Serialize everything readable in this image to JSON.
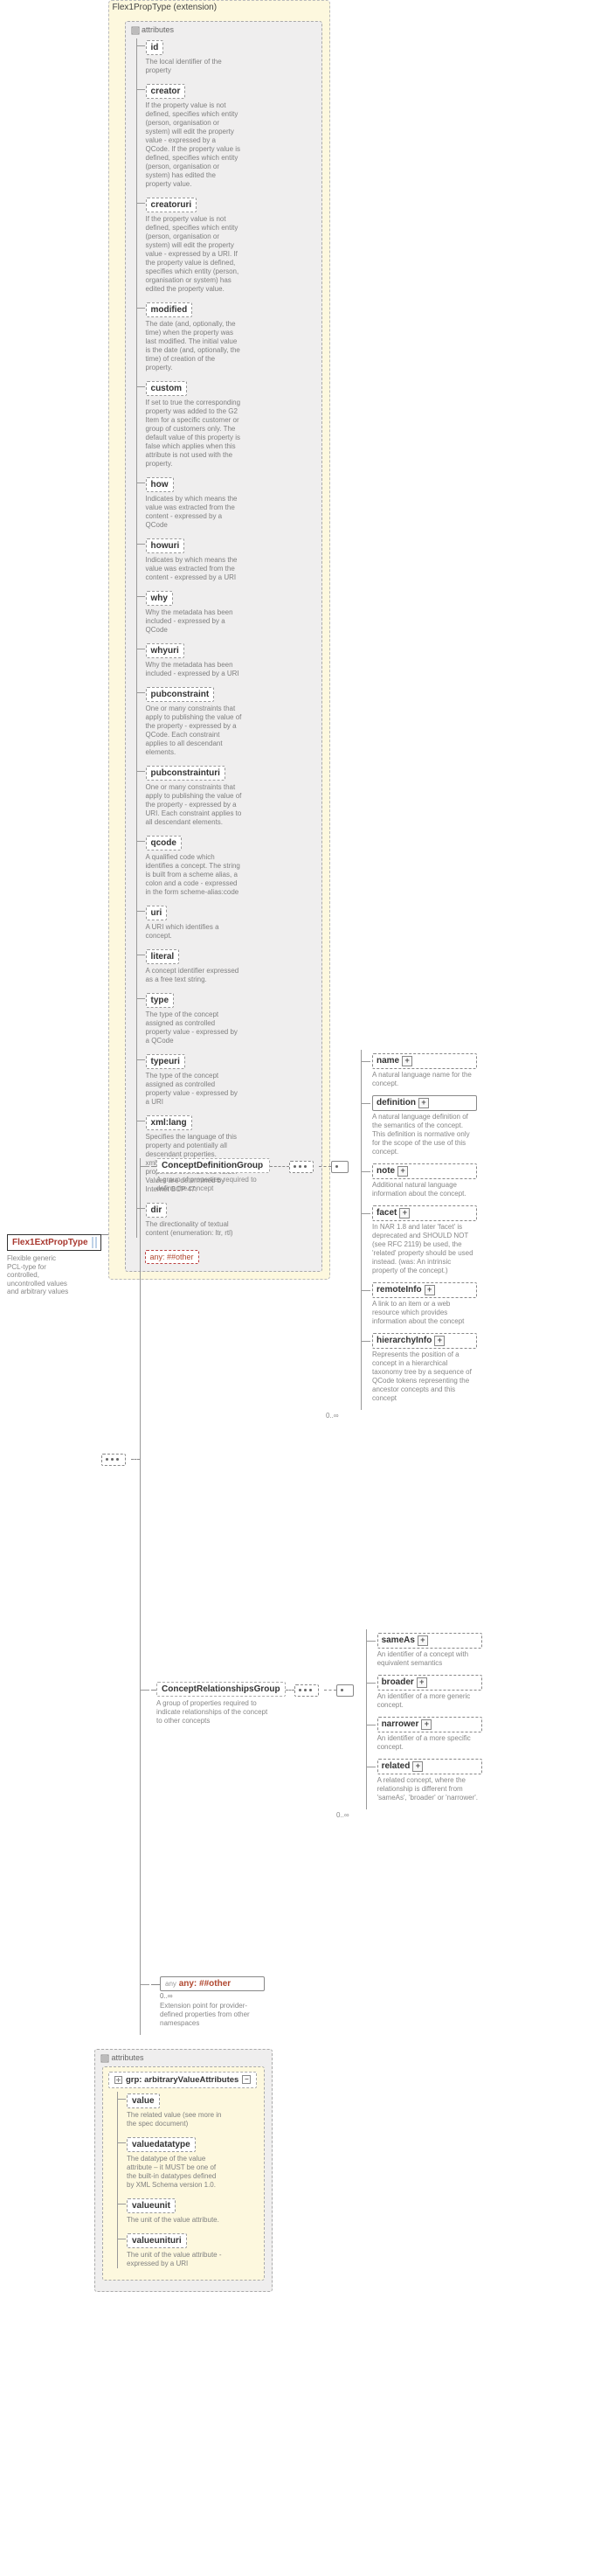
{
  "root": {
    "label": "Flex1ExtPropType",
    "desc": "Flexible generic PCL-type for controlled, uncontrolled values and arbitrary values"
  },
  "extension": {
    "title": "Flex1PropType (extension)"
  },
  "attributes_title": "attributes",
  "attrs": [
    {
      "name": "id",
      "desc": "The local identifier of the property"
    },
    {
      "name": "creator",
      "desc": "If the property value is not defined, specifies which entity (person, organisation or system) will edit the property value - expressed by a QCode. If the property value is defined, specifies which entity (person, organisation or system) has edited the property value."
    },
    {
      "name": "creatoruri",
      "desc": "If the property value is not defined, specifies which entity (person, organisation or system) will edit the property value - expressed by a URI. If the property value is defined, specifies which entity (person, organisation or system) has edited the property value."
    },
    {
      "name": "modified",
      "desc": "The date (and, optionally, the time) when the property was last modified. The initial value is the date (and, optionally, the time) of creation of the property."
    },
    {
      "name": "custom",
      "desc": "If set to true the corresponding property was added to the G2 Item for a specific customer or group of customers only. The default value of this property is false which applies when this attribute is not used with the property."
    },
    {
      "name": "how",
      "desc": "Indicates by which means the value was extracted from the content - expressed by a QCode"
    },
    {
      "name": "howuri",
      "desc": "Indicates by which means the value was extracted from the content - expressed by a URI"
    },
    {
      "name": "why",
      "desc": "Why the metadata has been included - expressed by a QCode"
    },
    {
      "name": "whyuri",
      "desc": "Why the metadata has been included - expressed by a URI"
    },
    {
      "name": "pubconstraint",
      "desc": "One or many constraints that apply to publishing the value of the property - expressed by a QCode. Each constraint applies to all descendant elements."
    },
    {
      "name": "pubconstrainturi",
      "desc": "One or many constraints that apply to publishing the value of the property - expressed by a URI. Each constraint applies to all descendant elements."
    },
    {
      "name": "qcode",
      "desc": "A qualified code which identifies a concept. The string is built from a scheme alias, a colon and a code - expressed in the form scheme-alias:code"
    },
    {
      "name": "uri",
      "desc": "A URI which identifies a concept."
    },
    {
      "name": "literal",
      "desc": "A concept identifier expressed as a free text string."
    },
    {
      "name": "type",
      "desc": "The type of the concept assigned as controlled property value - expressed by a QCode"
    },
    {
      "name": "typeuri",
      "desc": "The type of the concept assigned as controlled property value - expressed by a URI"
    },
    {
      "name": "xml:lang",
      "desc": "Specifies the language of this property and potentially all descendant properties. xml:lang values of descendant properties override this value. Values are determined by Internet BCP 47."
    },
    {
      "name": "dir",
      "desc": "The directionality of textual content (enumeration: ltr, rtl)"
    }
  ],
  "any_attr": "any: ##other",
  "concept_def": {
    "label": "ConceptDefinitionGroup",
    "desc": "A group of properties required to define the concept"
  },
  "concept_rel": {
    "label": "ConceptRelationshipsGroup",
    "desc": "A group of properties required to indicate relationships of the concept to other concepts"
  },
  "children_def": [
    {
      "name": "name",
      "desc": "A natural language name for the concept."
    },
    {
      "name": "definition",
      "desc": "A natural language definition of the semantics of the concept. This definition is normative only for the scope of the use of this concept."
    },
    {
      "name": "note",
      "desc": "Additional natural language information about the concept."
    },
    {
      "name": "facet",
      "desc": "In NAR 1.8 and later 'facet' is deprecated and SHOULD NOT (see RFC 2119) be used, the 'related' property should be used instead. (was: An intrinsic property of the concept.)"
    },
    {
      "name": "remoteInfo",
      "desc": "A link to an item or a web resource which provides information about the concept"
    },
    {
      "name": "hierarchyInfo",
      "desc": "Represents the position of a concept in a hierarchical taxonomy tree by a sequence of QCode tokens representing the ancestor concepts and this concept"
    }
  ],
  "children_rel": [
    {
      "name": "sameAs",
      "desc": "An identifier of a concept with equivalent semantics"
    },
    {
      "name": "broader",
      "desc": "An identifier of a more generic concept."
    },
    {
      "name": "narrower",
      "desc": "An identifier of a more specific concept."
    },
    {
      "name": "related",
      "desc": "A related concept, where the relationship is different from 'sameAs', 'broader' or 'narrower'."
    }
  ],
  "any_elem": {
    "label": "any: ##other",
    "desc": "Extension point for provider-defined properties from other namespaces",
    "card": "0..∞"
  },
  "card_inf": "0..∞",
  "attr2_title": "attributes",
  "arb_group": {
    "label": "grp: arbitraryValueAttributes"
  },
  "arb_attrs": [
    {
      "name": "value",
      "desc": "The related value (see more in the spec document)"
    },
    {
      "name": "valuedatatype",
      "desc": "The datatype of the value attribute – it MUST be one of the built-in datatypes defined by XML Schema version 1.0."
    },
    {
      "name": "valueunit",
      "desc": "The unit of the value attribute."
    },
    {
      "name": "valueunituri",
      "desc": "The unit of the value attribute - expressed by a URI"
    }
  ]
}
